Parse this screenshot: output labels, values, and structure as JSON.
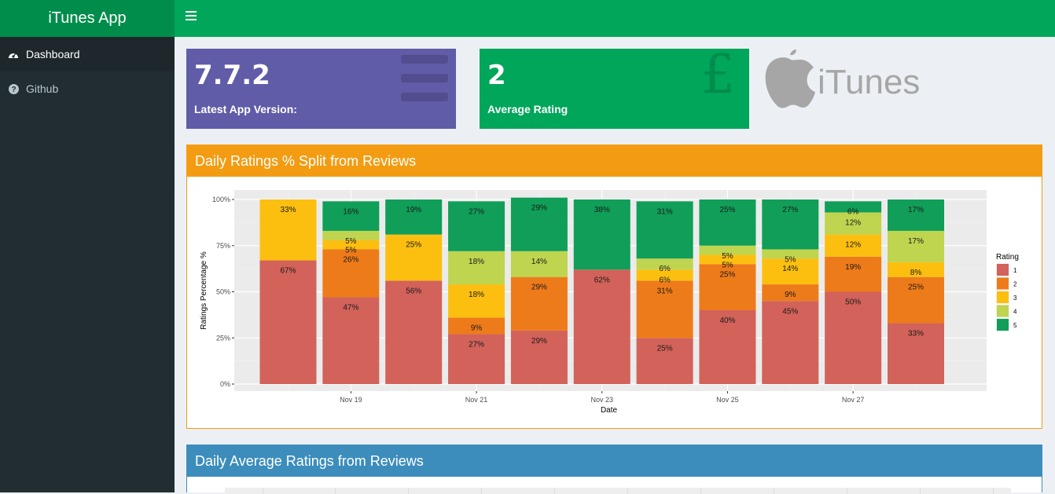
{
  "app": {
    "title": "iTunes App"
  },
  "sidebar": {
    "items": [
      {
        "label": "Dashboard"
      },
      {
        "label": "Github"
      }
    ]
  },
  "value_boxes": [
    {
      "value": "7.7.2",
      "label": "Latest App Version:"
    },
    {
      "value": "2",
      "label": "Average Rating"
    }
  ],
  "logo": {
    "text": "iTunes"
  },
  "panels": [
    {
      "title": "Daily Ratings % Split from Reviews"
    },
    {
      "title": "Daily Average Ratings from Reviews"
    }
  ],
  "colors": {
    "green": "#00a65a",
    "purple": "#605ca8",
    "orange": "#f39c12",
    "blue": "#3c8dbc"
  },
  "chart_data": {
    "type": "bar",
    "stacked": true,
    "xlabel": "Date",
    "ylabel": "Ratings Percentage %",
    "ylim": [
      0,
      100
    ],
    "y_ticks": [
      "0%",
      "25%",
      "50%",
      "75%",
      "100%"
    ],
    "x_tick_labels": [
      "Nov 19",
      "Nov 21",
      "Nov 23",
      "Nov 25",
      "Nov 27"
    ],
    "categories": [
      "Nov 18",
      "Nov 19",
      "Nov 20",
      "Nov 21",
      "Nov 22",
      "Nov 23",
      "Nov 24",
      "Nov 25",
      "Nov 26",
      "Nov 27",
      "Nov 28"
    ],
    "legend": {
      "title": "Rating",
      "position": "right"
    },
    "series": [
      {
        "name": "1",
        "color": "#d2625a",
        "values": [
          67,
          47,
          56,
          27,
          29,
          62,
          25,
          40,
          45,
          50,
          33
        ]
      },
      {
        "name": "2",
        "color": "#ee7b1a",
        "values": [
          0,
          26,
          0,
          9,
          29,
          0,
          31,
          25,
          9,
          19,
          25
        ]
      },
      {
        "name": "3",
        "color": "#fcbf10",
        "values": [
          33,
          5,
          25,
          18,
          0,
          0,
          6,
          5,
          14,
          12,
          8
        ]
      },
      {
        "name": "4",
        "color": "#bfd44f",
        "values": [
          0,
          5,
          0,
          18,
          14,
          0,
          6,
          5,
          5,
          12,
          17
        ]
      },
      {
        "name": "5",
        "color": "#109e58",
        "values": [
          0,
          16,
          19,
          27,
          29,
          38,
          31,
          25,
          27,
          6,
          17
        ]
      }
    ]
  }
}
